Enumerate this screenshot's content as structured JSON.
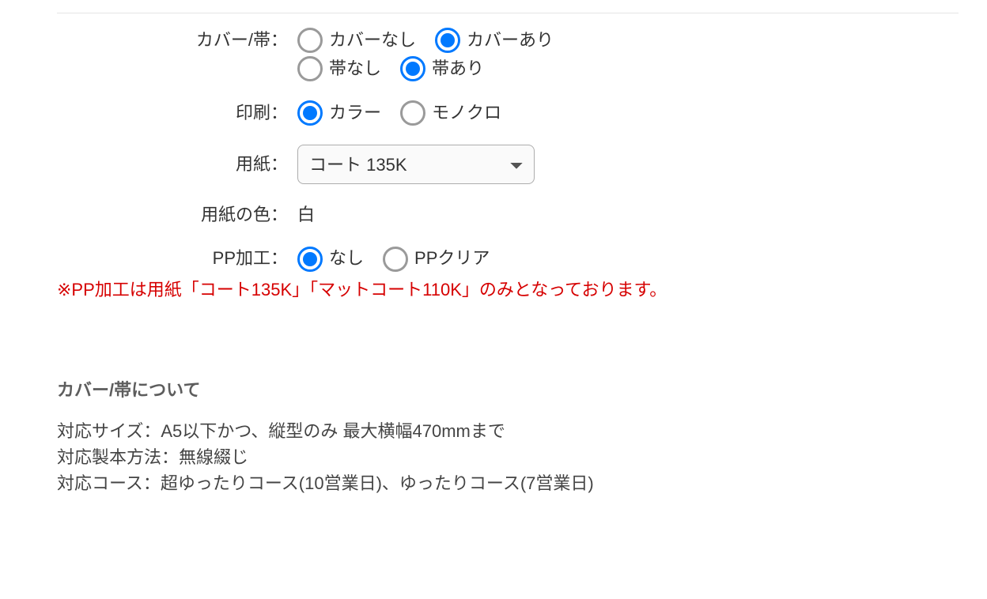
{
  "labels": {
    "cover_obi": "カバー/帯：",
    "print": "印刷：",
    "paper": "用紙：",
    "paper_color": "用紙の色：",
    "pp": "PP加工："
  },
  "cover": {
    "options": [
      {
        "label": "カバーなし",
        "checked": false
      },
      {
        "label": "カバーあり",
        "checked": true
      }
    ]
  },
  "obi": {
    "options": [
      {
        "label": "帯なし",
        "checked": false
      },
      {
        "label": "帯あり",
        "checked": true
      }
    ]
  },
  "print": {
    "options": [
      {
        "label": "カラー",
        "checked": true
      },
      {
        "label": "モノクロ",
        "checked": false
      }
    ]
  },
  "paper": {
    "selected": "コート 135K",
    "options": [
      "コート 135K"
    ]
  },
  "paper_color": {
    "value": "白"
  },
  "pp": {
    "options": [
      {
        "label": "なし",
        "checked": true
      },
      {
        "label": "PPクリア",
        "checked": false
      }
    ]
  },
  "note": "※PP加工は用紙「コート135K」「マットコート110K」のみとなっております。",
  "section_title": "カバー/帯について",
  "info": {
    "line1": "対応サイズ：A5以下かつ、縦型のみ 最大横幅470mmまで",
    "line2": "対応製本方法：無線綴じ",
    "line3": "対応コース：超ゆったりコース(10営業日)、ゆったりコース(7営業日)"
  }
}
